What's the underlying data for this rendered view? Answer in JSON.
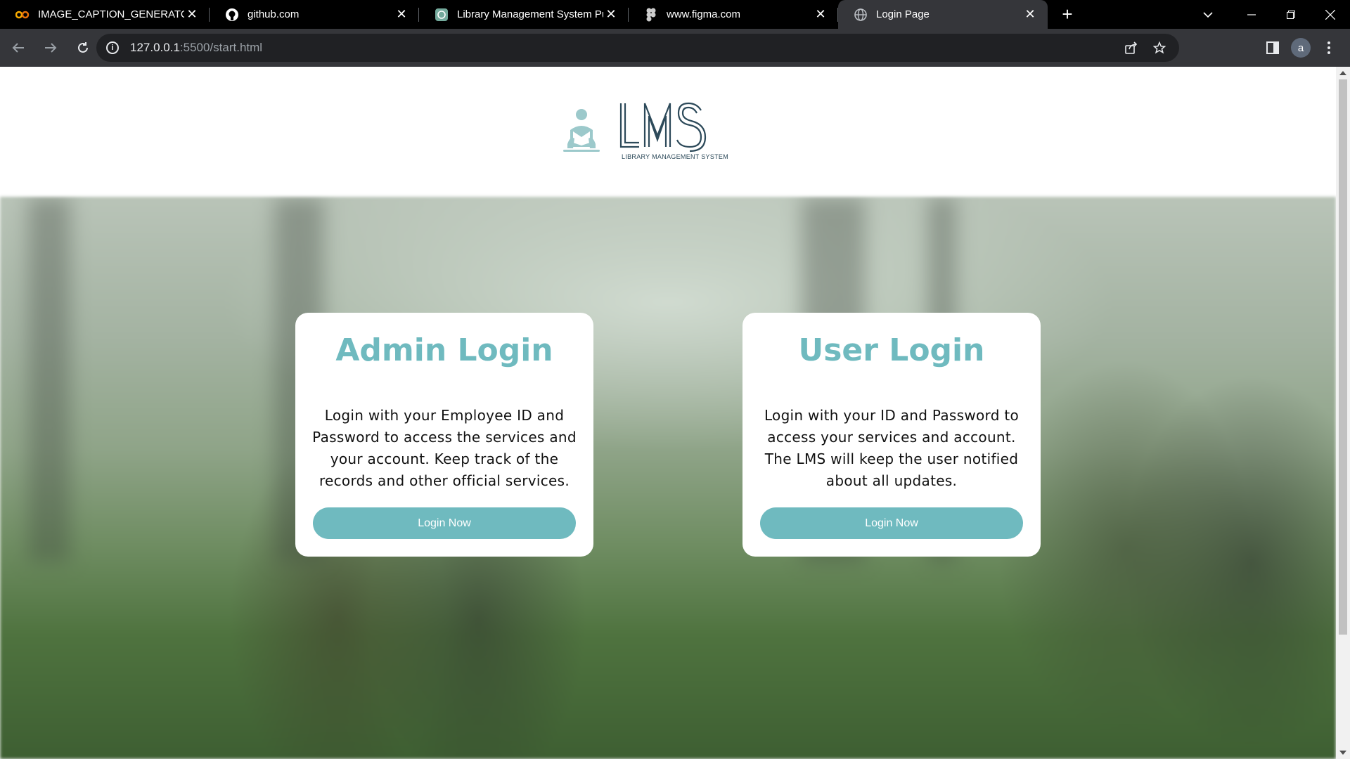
{
  "browser": {
    "tabs": [
      {
        "title": "IMAGE_CAPTION_GENERATOR.ip",
        "favicon": "colab-icon",
        "active": false
      },
      {
        "title": "github.com",
        "favicon": "github-icon",
        "active": false
      },
      {
        "title": "Library Management System Pur",
        "favicon": "chatgpt-icon",
        "active": false
      },
      {
        "title": "www.figma.com",
        "favicon": "figma-icon",
        "active": false
      },
      {
        "title": "Login Page",
        "favicon": "globe-icon",
        "active": true
      }
    ],
    "url": {
      "host": "127.0.0.1",
      "path": ":5500/start.html"
    },
    "profile_initial": "a"
  },
  "logo": {
    "text": "LMS",
    "subtitle": "LIBRARY MANAGEMENT SYSTEM",
    "accent_color": "#9cc9cb",
    "dark_color": "#2d4a5a"
  },
  "cards": {
    "admin": {
      "title": "Admin Login",
      "description": "Login with your Employee ID and Password to access the services and your account. Keep track of the records and other official services.",
      "button": "Login Now"
    },
    "user": {
      "title": "User Login",
      "description": "Login with your ID and Password to access your services and account. The LMS will keep the user notified about all updates.",
      "button": "Login Now"
    }
  },
  "colors": {
    "accent": "#6fbabf",
    "card_bg": "#ffffff",
    "chrome_dark": "#35363a"
  }
}
